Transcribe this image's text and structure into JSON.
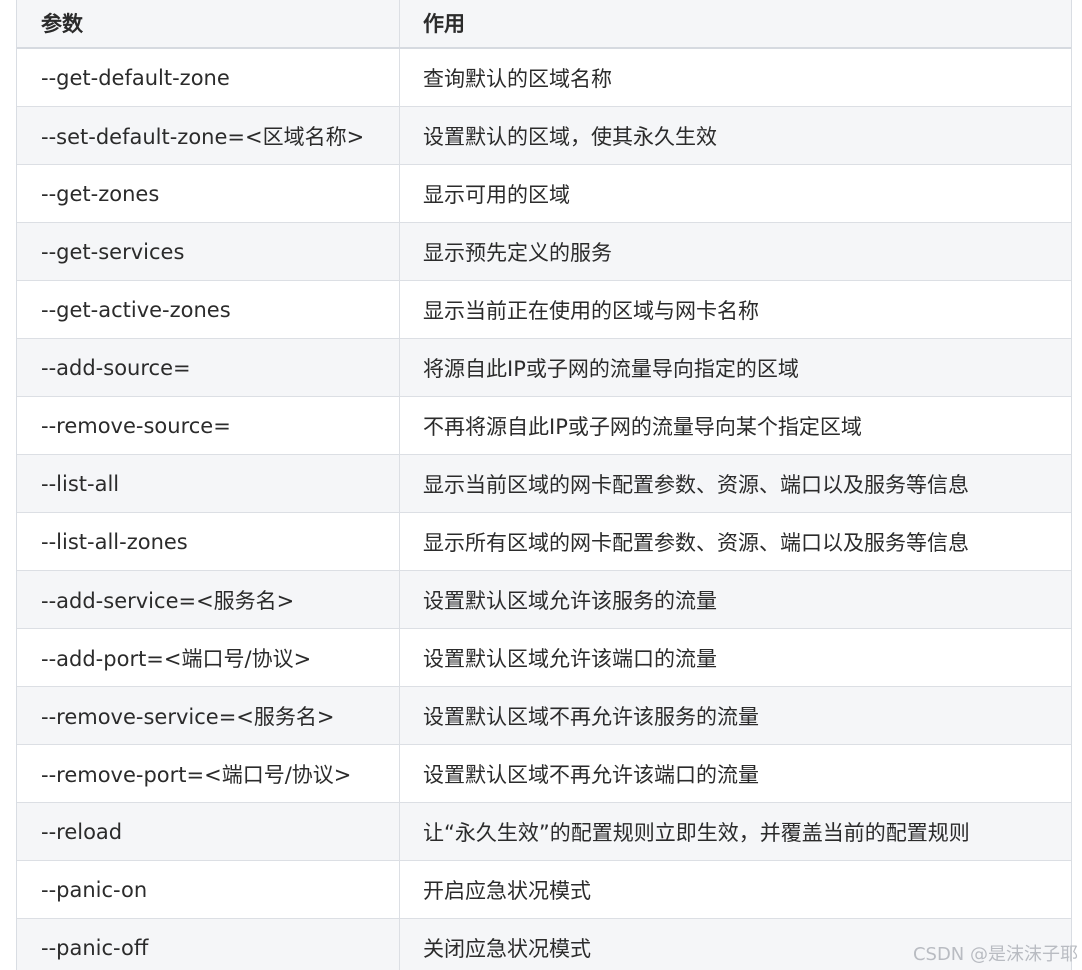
{
  "table": {
    "headers": [
      "参数",
      "作用"
    ],
    "rows": [
      {
        "param": "--get-default-zone",
        "desc": "查询默认的区域名称"
      },
      {
        "param": "--set-default-zone=<区域名称>",
        "desc": "设置默认的区域，使其永久生效"
      },
      {
        "param": "--get-zones",
        "desc": "显示可用的区域"
      },
      {
        "param": "--get-services",
        "desc": "显示预先定义的服务"
      },
      {
        "param": "--get-active-zones",
        "desc": "显示当前正在使用的区域与网卡名称"
      },
      {
        "param": "--add-source=",
        "desc": "将源自此IP或子网的流量导向指定的区域"
      },
      {
        "param": "--remove-source=",
        "desc": "不再将源自此IP或子网的流量导向某个指定区域"
      },
      {
        "param": "--list-all",
        "desc": "显示当前区域的网卡配置参数、资源、端口以及服务等信息"
      },
      {
        "param": "--list-all-zones",
        "desc": "显示所有区域的网卡配置参数、资源、端口以及服务等信息"
      },
      {
        "param": "--add-service=<服务名>",
        "desc": "设置默认区域允许该服务的流量"
      },
      {
        "param": "--add-port=<端口号/协议>",
        "desc": "设置默认区域允许该端口的流量"
      },
      {
        "param": "--remove-service=<服务名>",
        "desc": "设置默认区域不再允许该服务的流量"
      },
      {
        "param": "--remove-port=<端口号/协议>",
        "desc": "设置默认区域不再允许该端口的流量"
      },
      {
        "param": "--reload",
        "desc": "让“永久生效”的配置规则立即生效，并覆盖当前的配置规则"
      },
      {
        "param": "--panic-on",
        "desc": "开启应急状况模式"
      },
      {
        "param": "--panic-off",
        "desc": "关闭应急状况模式"
      }
    ]
  },
  "watermark": "CSDN @是沫沫子耶",
  "colors": {
    "row_alt": "#f5f6f8",
    "row_white": "#ffffff",
    "border": "#dcdfe4",
    "text": "#2b2b2b"
  }
}
